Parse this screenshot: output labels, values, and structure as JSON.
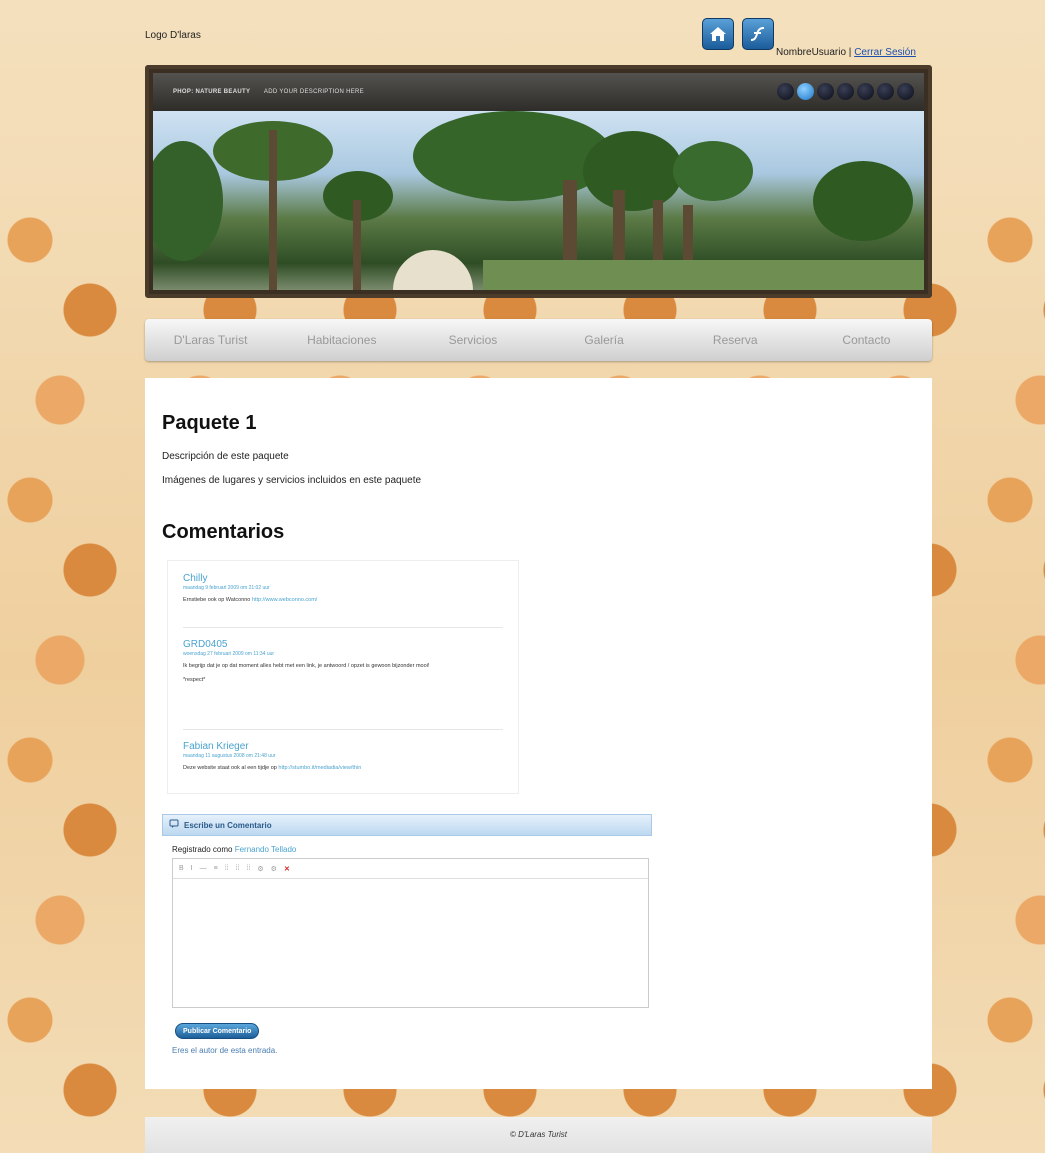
{
  "header": {
    "logo_text": "Logo D'laras",
    "username": "NombreUsuario",
    "separator": " | ",
    "logout_label": "Cerrar Sesión"
  },
  "icons": {
    "home": "home-icon",
    "flash": "flash-icon"
  },
  "banner": {
    "caption_title": "PHOP: NATURE BEAUTY",
    "caption_desc": "ADD YOUR DESCRIPTION HERE",
    "slide_count": 7,
    "active_slide": 2
  },
  "nav": {
    "items": [
      {
        "label": "D'Laras Turist"
      },
      {
        "label": "Habitaciones"
      },
      {
        "label": "Servicios"
      },
      {
        "label": "Galería"
      },
      {
        "label": "Reserva"
      },
      {
        "label": "Contacto"
      }
    ]
  },
  "main": {
    "package_title": "Paquete 1",
    "package_description": "Descripción de este paquete",
    "package_images_text": "Imágenes de lugares y servicios incluidos en este paquete",
    "comments_title": "Comentarios"
  },
  "comments": [
    {
      "author": "Chilly",
      "meta": "maandag 9 februari 2009 om 21:02 uur",
      "text": "Ernstiebe ook op Watconno",
      "link": "http://www.webconno.com/"
    },
    {
      "author": "GRD0405",
      "meta": "woensdag 27 februari 2009 om 11:34 uur",
      "text": "Ik begrijp dat je op dat moment alles hebt met een link, je antwoord / opzet is gewoon bijzonder mooi!",
      "text2": "*respect*",
      "link": ""
    },
    {
      "author": "Fabian Krieger",
      "meta": "maandag 11 augustus 2008 om 21:48 uur",
      "text": "Deze website staat ook al een tijdje op",
      "link": "http://stumbo.it/mediadia/view/thin"
    }
  ],
  "reply": {
    "heading": "Escribe un Comentario",
    "registered_prefix": "Registrado como ",
    "registered_user": "Fernando Tellado",
    "toolbar": [
      "B",
      "I",
      "—",
      "≡",
      "⁞⁞",
      "⁞⁞",
      "⁞⁞",
      "⚙",
      "⚙",
      "✕"
    ],
    "publish_label": "Publicar Comentario",
    "author_note": "Eres el autor de esta entrada."
  },
  "footer": {
    "text": "© D'Laras Turist"
  },
  "colors": {
    "link": "#4aa3d0",
    "background": "#f3dcb6",
    "accent_blue": "#1e5f9a"
  }
}
